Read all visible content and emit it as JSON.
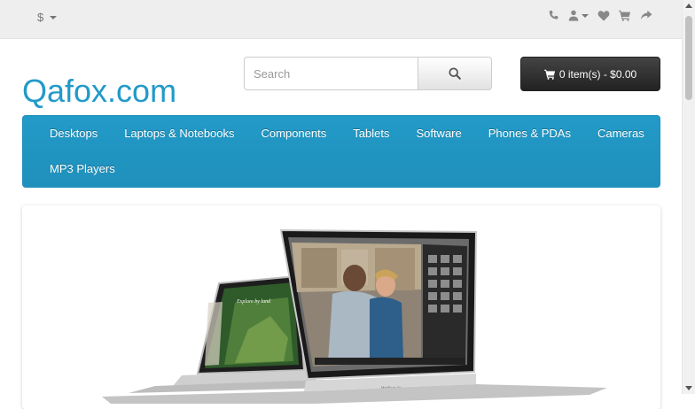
{
  "topbar": {
    "currency_symbol": "$",
    "icons": [
      "phone-icon",
      "user-icon",
      "heart-icon",
      "cart-icon",
      "share-icon"
    ]
  },
  "header": {
    "logo": "Qafox.com",
    "search_placeholder": "Search",
    "cart_label": "0 item(s) - $0.00"
  },
  "menu": {
    "items": [
      "Desktops",
      "Laptops & Notebooks",
      "Components",
      "Tablets",
      "Software",
      "Phones & PDAs",
      "Cameras",
      "MP3 Players"
    ]
  },
  "slideshow": {
    "screen_text_small": "Explore by land",
    "laptop_brand": "MacBook Air"
  },
  "colors": {
    "accent": "#229ac8",
    "topbar_bg": "#eeeeee",
    "cart_bg": "#333333"
  }
}
